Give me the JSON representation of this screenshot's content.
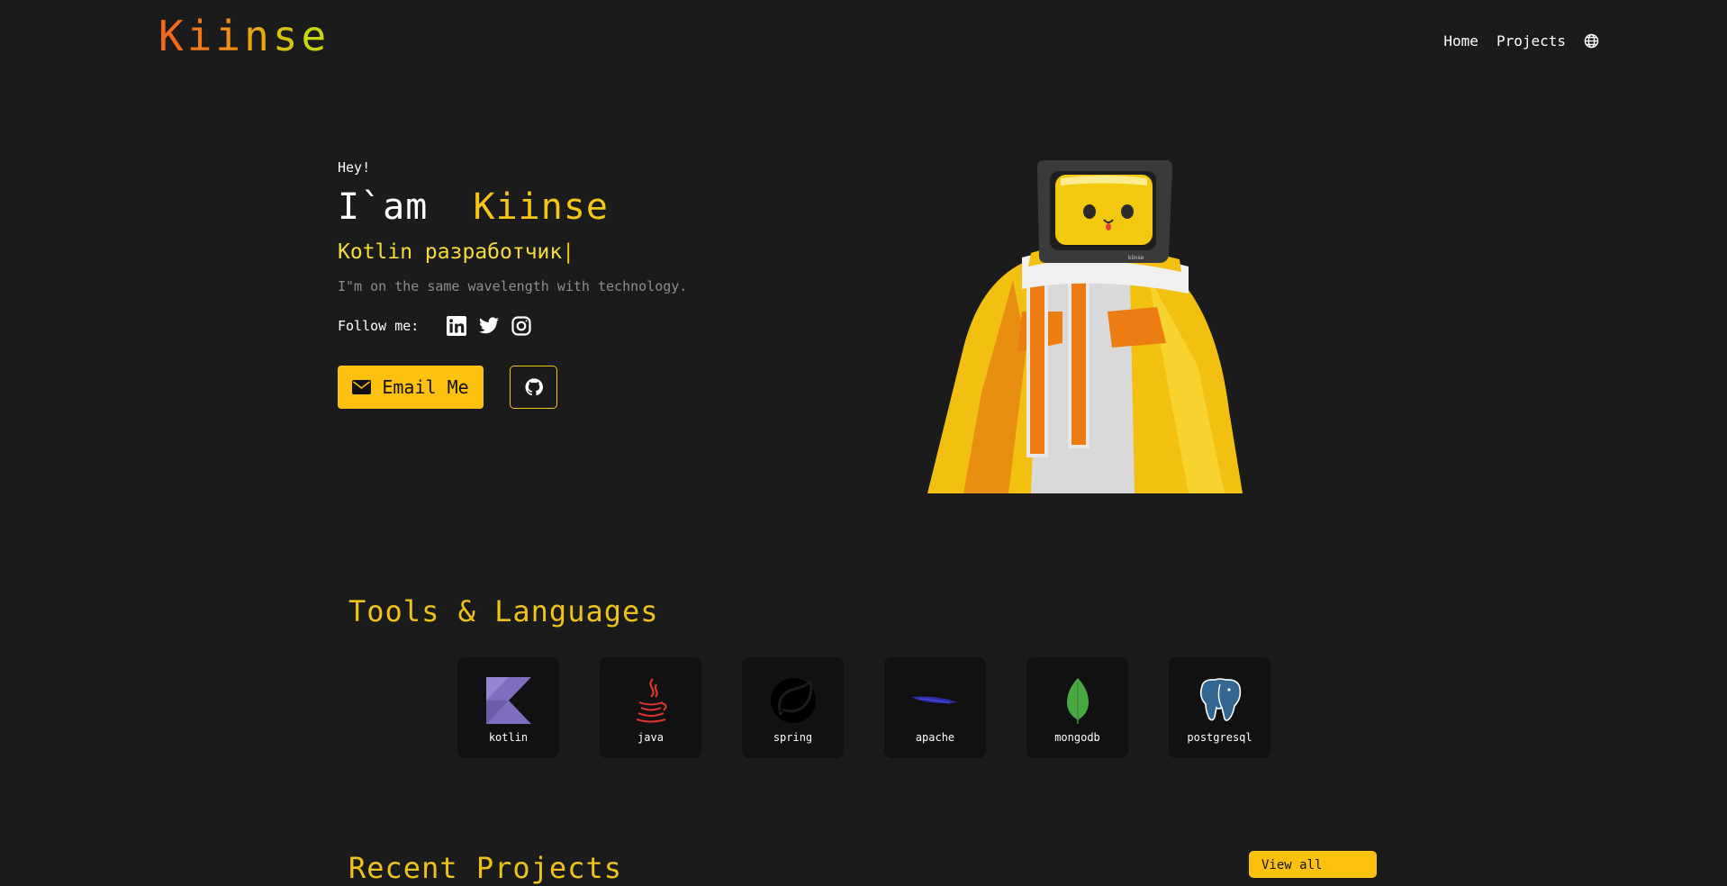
{
  "header": {
    "logo_letters": [
      "K",
      "i",
      "i",
      "n",
      "s",
      "e"
    ],
    "logo_colors": [
      "#f26a1b",
      "#f2791a",
      "#f08e16",
      "#e6ab10",
      "#d7c30e",
      "#c8d80c"
    ],
    "nav": {
      "home": "Home",
      "projects": "Projects",
      "language_icon": "globe-icon"
    }
  },
  "hero": {
    "greeting": "Hey!",
    "iam_prefix": "I`am  ",
    "name": "Kiinse",
    "role": "Kotlin разработчик",
    "cursor": "|",
    "tagline": "I\"m on the same wavelength with technology.",
    "follow_label": "Follow me:",
    "social_icons": [
      "linkedin-icon",
      "twitter-icon",
      "instagram-icon"
    ],
    "email_button": "Email Me",
    "github_icon": "github-icon"
  },
  "tools": {
    "title": "Tools & Languages",
    "items": [
      {
        "name": "kotlin",
        "icon": "kotlin-icon"
      },
      {
        "name": "java",
        "icon": "java-icon"
      },
      {
        "name": "spring",
        "icon": "spring-icon"
      },
      {
        "name": "apache",
        "icon": "apache-icon"
      },
      {
        "name": "mongodb",
        "icon": "mongodb-icon"
      },
      {
        "name": "postgresql",
        "icon": "postgresql-icon"
      }
    ]
  },
  "projects": {
    "title": "Recent Projects",
    "view_button": "View all"
  },
  "colors": {
    "background": "#1b1b1b",
    "accent": "#fcc10e",
    "accent_text": "#f5c518",
    "muted_text": "#8d8d8d"
  }
}
